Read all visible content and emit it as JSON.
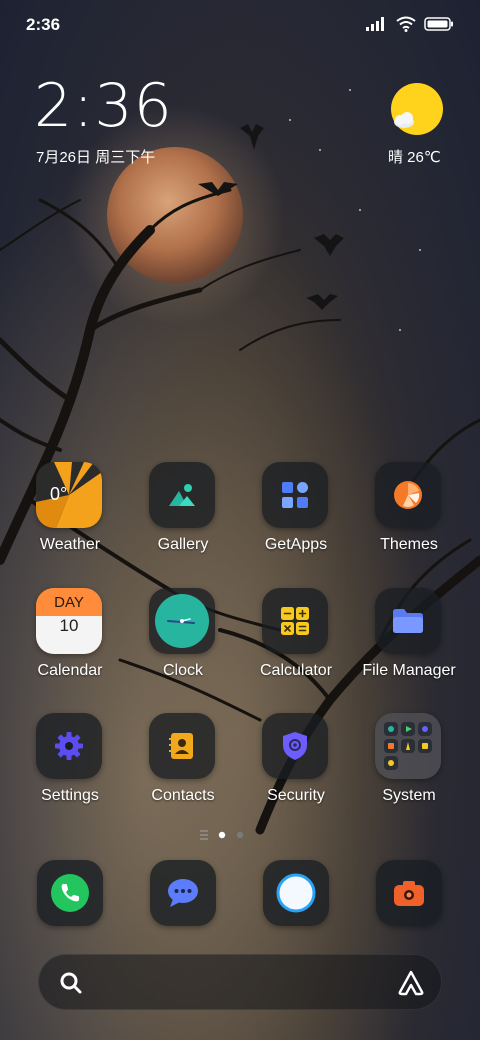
{
  "status_bar": {
    "time": "2:36"
  },
  "clock_widget": {
    "time": "2:36",
    "date": "7月26日 周三下午"
  },
  "weather_widget": {
    "condition": "晴",
    "temperature": "26℃",
    "text": "晴 26℃"
  },
  "apps": [
    {
      "label": "Weather",
      "icon": "weather-icon",
      "badge": "0°"
    },
    {
      "label": "Gallery",
      "icon": "gallery-icon"
    },
    {
      "label": "GetApps",
      "icon": "getapps-icon"
    },
    {
      "label": "Themes",
      "icon": "themes-icon"
    },
    {
      "label": "Calendar",
      "icon": "calendar-icon",
      "badge_top": "DAY",
      "badge_num": "10"
    },
    {
      "label": "Clock",
      "icon": "clock-icon"
    },
    {
      "label": "Calculator",
      "icon": "calculator-icon"
    },
    {
      "label": "File Manager",
      "icon": "file-manager-icon"
    },
    {
      "label": "Settings",
      "icon": "settings-icon"
    },
    {
      "label": "Contacts",
      "icon": "contacts-icon"
    },
    {
      "label": "Security",
      "icon": "security-icon"
    },
    {
      "label": "System",
      "icon": "system-folder-icon"
    }
  ],
  "dock": [
    {
      "icon": "phone-icon"
    },
    {
      "icon": "messaging-icon"
    },
    {
      "icon": "browser-icon"
    },
    {
      "icon": "camera-icon"
    }
  ],
  "page_indicator": {
    "pages": 2,
    "current": 1
  },
  "colors": {
    "accent_green": "#22c55e",
    "accent_orange": "#f47a2a",
    "accent_yellow": "#f7c81e",
    "accent_purple": "#6d5dfc",
    "accent_teal": "#27b5a0",
    "sun": "#ffd21c"
  }
}
